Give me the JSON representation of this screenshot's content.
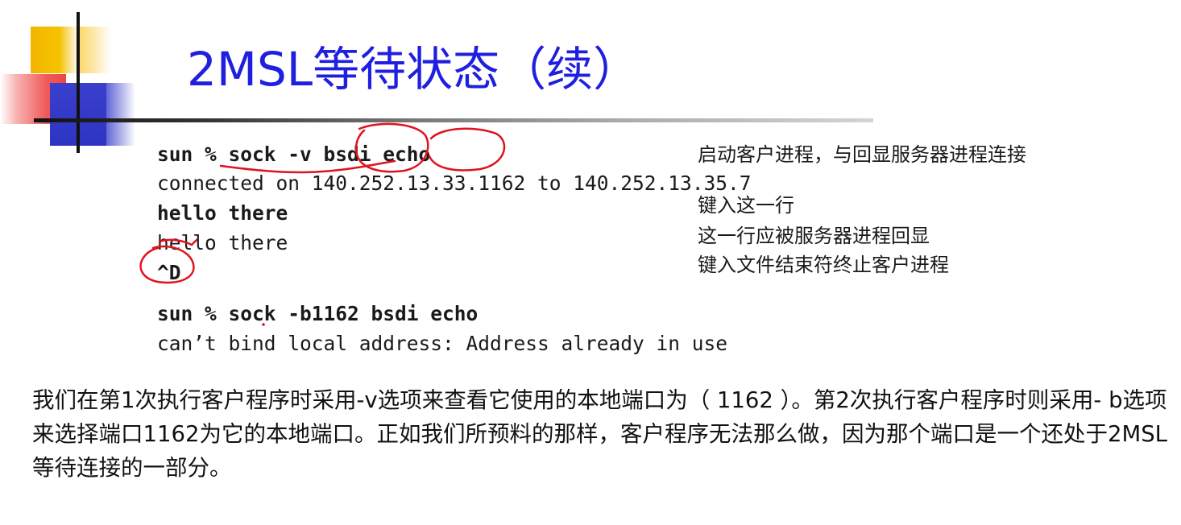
{
  "slide": {
    "title": "2MSL等待状态（续）",
    "terminal_lines": [
      "sun % sock -v bsdi echo",
      "connected on 140.252.13.33.1162 to 140.252.13.35.7",
      "hello there",
      "hello there",
      "^D",
      "sun % sock -b1162 bsdi echo",
      "can’t bind local address: Address already in use"
    ],
    "annotations": [
      "启动客户进程，与回显服务器进程连接",
      "键入这一行",
      "这一行应被服务器进程回显",
      "键入文件结束符终止客户进程"
    ],
    "explanation": "我们在第1次执行客户程序时采用-v选项来查看它使用的本地端口为（ 1162 ）。第2次执行客户程序时则采用- b选项来选择端口1162为它的本地端口。正如我们所预料的那样，客户程序无法那么做，因为那个端口是一个还处于2MSL等待连接的一部分。"
  },
  "colors": {
    "title": "#1f1fe0",
    "annotation_ink": "#e0121e",
    "logo_yellow": "#f2b400",
    "logo_red": "#ee4444",
    "logo_blue": "#2e34c2"
  }
}
